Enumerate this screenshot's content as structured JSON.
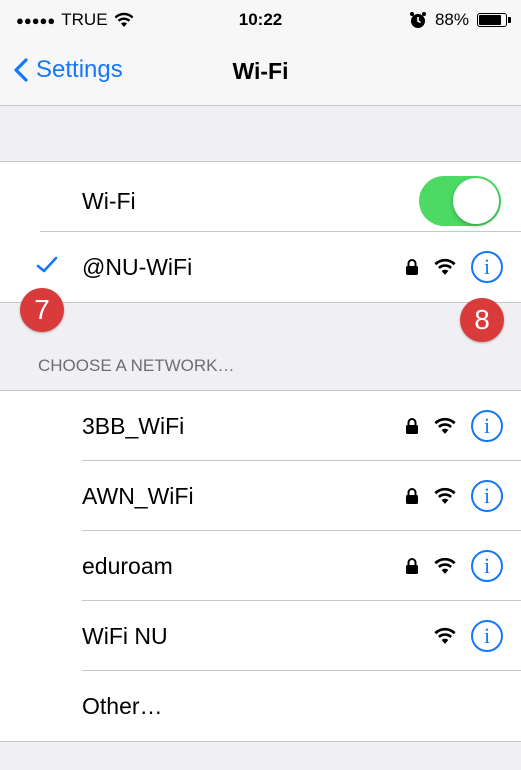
{
  "status_bar": {
    "carrier": "TRUE",
    "time": "10:22",
    "battery_percent_text": "88%",
    "battery_level": 0.88
  },
  "nav": {
    "back_label": "Settings",
    "title": "Wi-Fi"
  },
  "wifi_toggle": {
    "label": "Wi-Fi",
    "on": true
  },
  "connected": {
    "name": "@NU-WiFi",
    "locked": true
  },
  "section_header": "CHOOSE A NETWORK…",
  "networks": [
    {
      "name": "3BB_WiFi",
      "locked": true
    },
    {
      "name": "AWN_WiFi",
      "locked": true
    },
    {
      "name": "eduroam",
      "locked": true
    },
    {
      "name": "WiFi NU",
      "locked": false
    }
  ],
  "other": "Other…",
  "annotations": {
    "badge_left": "7",
    "badge_right": "8"
  },
  "colors": {
    "accent": "#1577fb",
    "toggle_on": "#4cd964",
    "badge": "#d93a3a",
    "background": "#efeff4"
  },
  "icons": {
    "info": "i"
  }
}
